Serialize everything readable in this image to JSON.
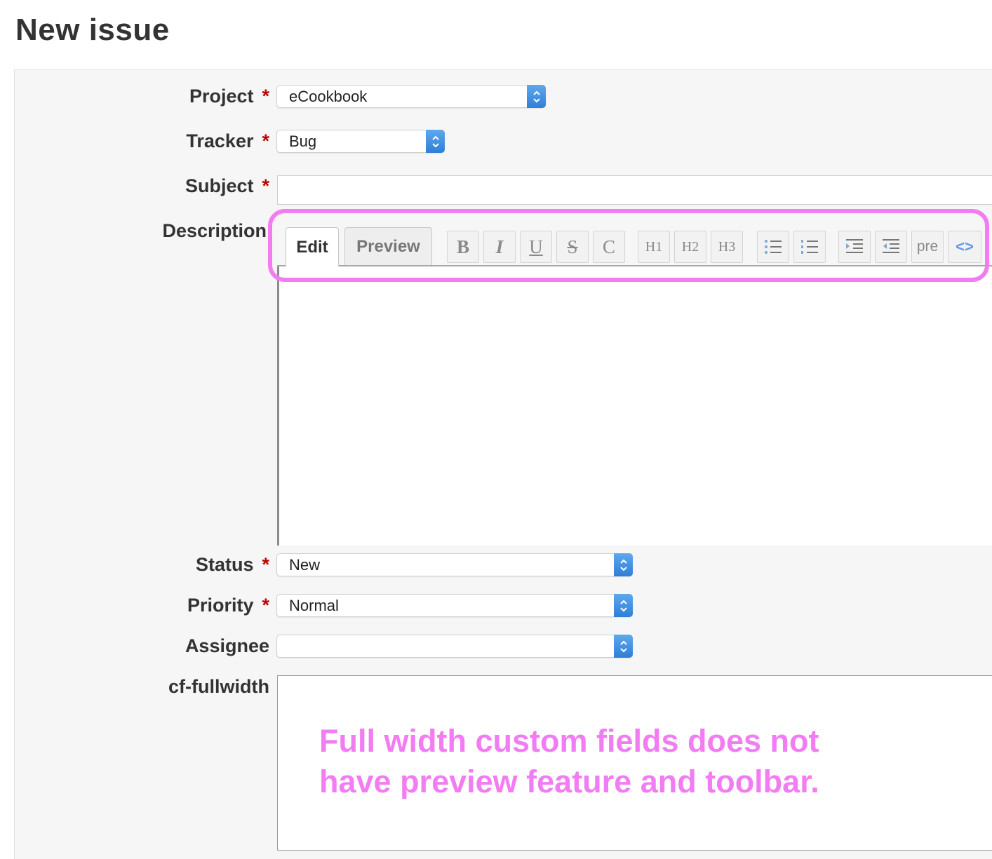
{
  "page": {
    "title": "New issue"
  },
  "form": {
    "project": {
      "label": "Project",
      "required_mark": "*",
      "value": "eCookbook"
    },
    "tracker": {
      "label": "Tracker",
      "required_mark": "*",
      "value": "Bug"
    },
    "subject": {
      "label": "Subject",
      "required_mark": "*",
      "value": ""
    },
    "description": {
      "label": "Description",
      "tabs": [
        "Edit",
        "Preview"
      ],
      "toolbar": [
        "B",
        "I",
        "U",
        "S",
        "C",
        "H1",
        "H2",
        "H3",
        "unordered-list",
        "ordered-list",
        "indent",
        "outdent",
        "pre",
        "code"
      ]
    },
    "status": {
      "label": "Status",
      "required_mark": "*",
      "value": "New"
    },
    "priority": {
      "label": "Priority",
      "required_mark": "*",
      "value": "Normal"
    },
    "assignee": {
      "label": "Assignee",
      "value": ""
    },
    "cf_fullwidth": {
      "label": "cf-fullwidth"
    }
  },
  "toolbar_labels": {
    "pre": "pre"
  },
  "annotation": {
    "line1": "Full width custom fields does not",
    "line2": "have preview feature and toolbar.",
    "color": "#f27cf2"
  }
}
